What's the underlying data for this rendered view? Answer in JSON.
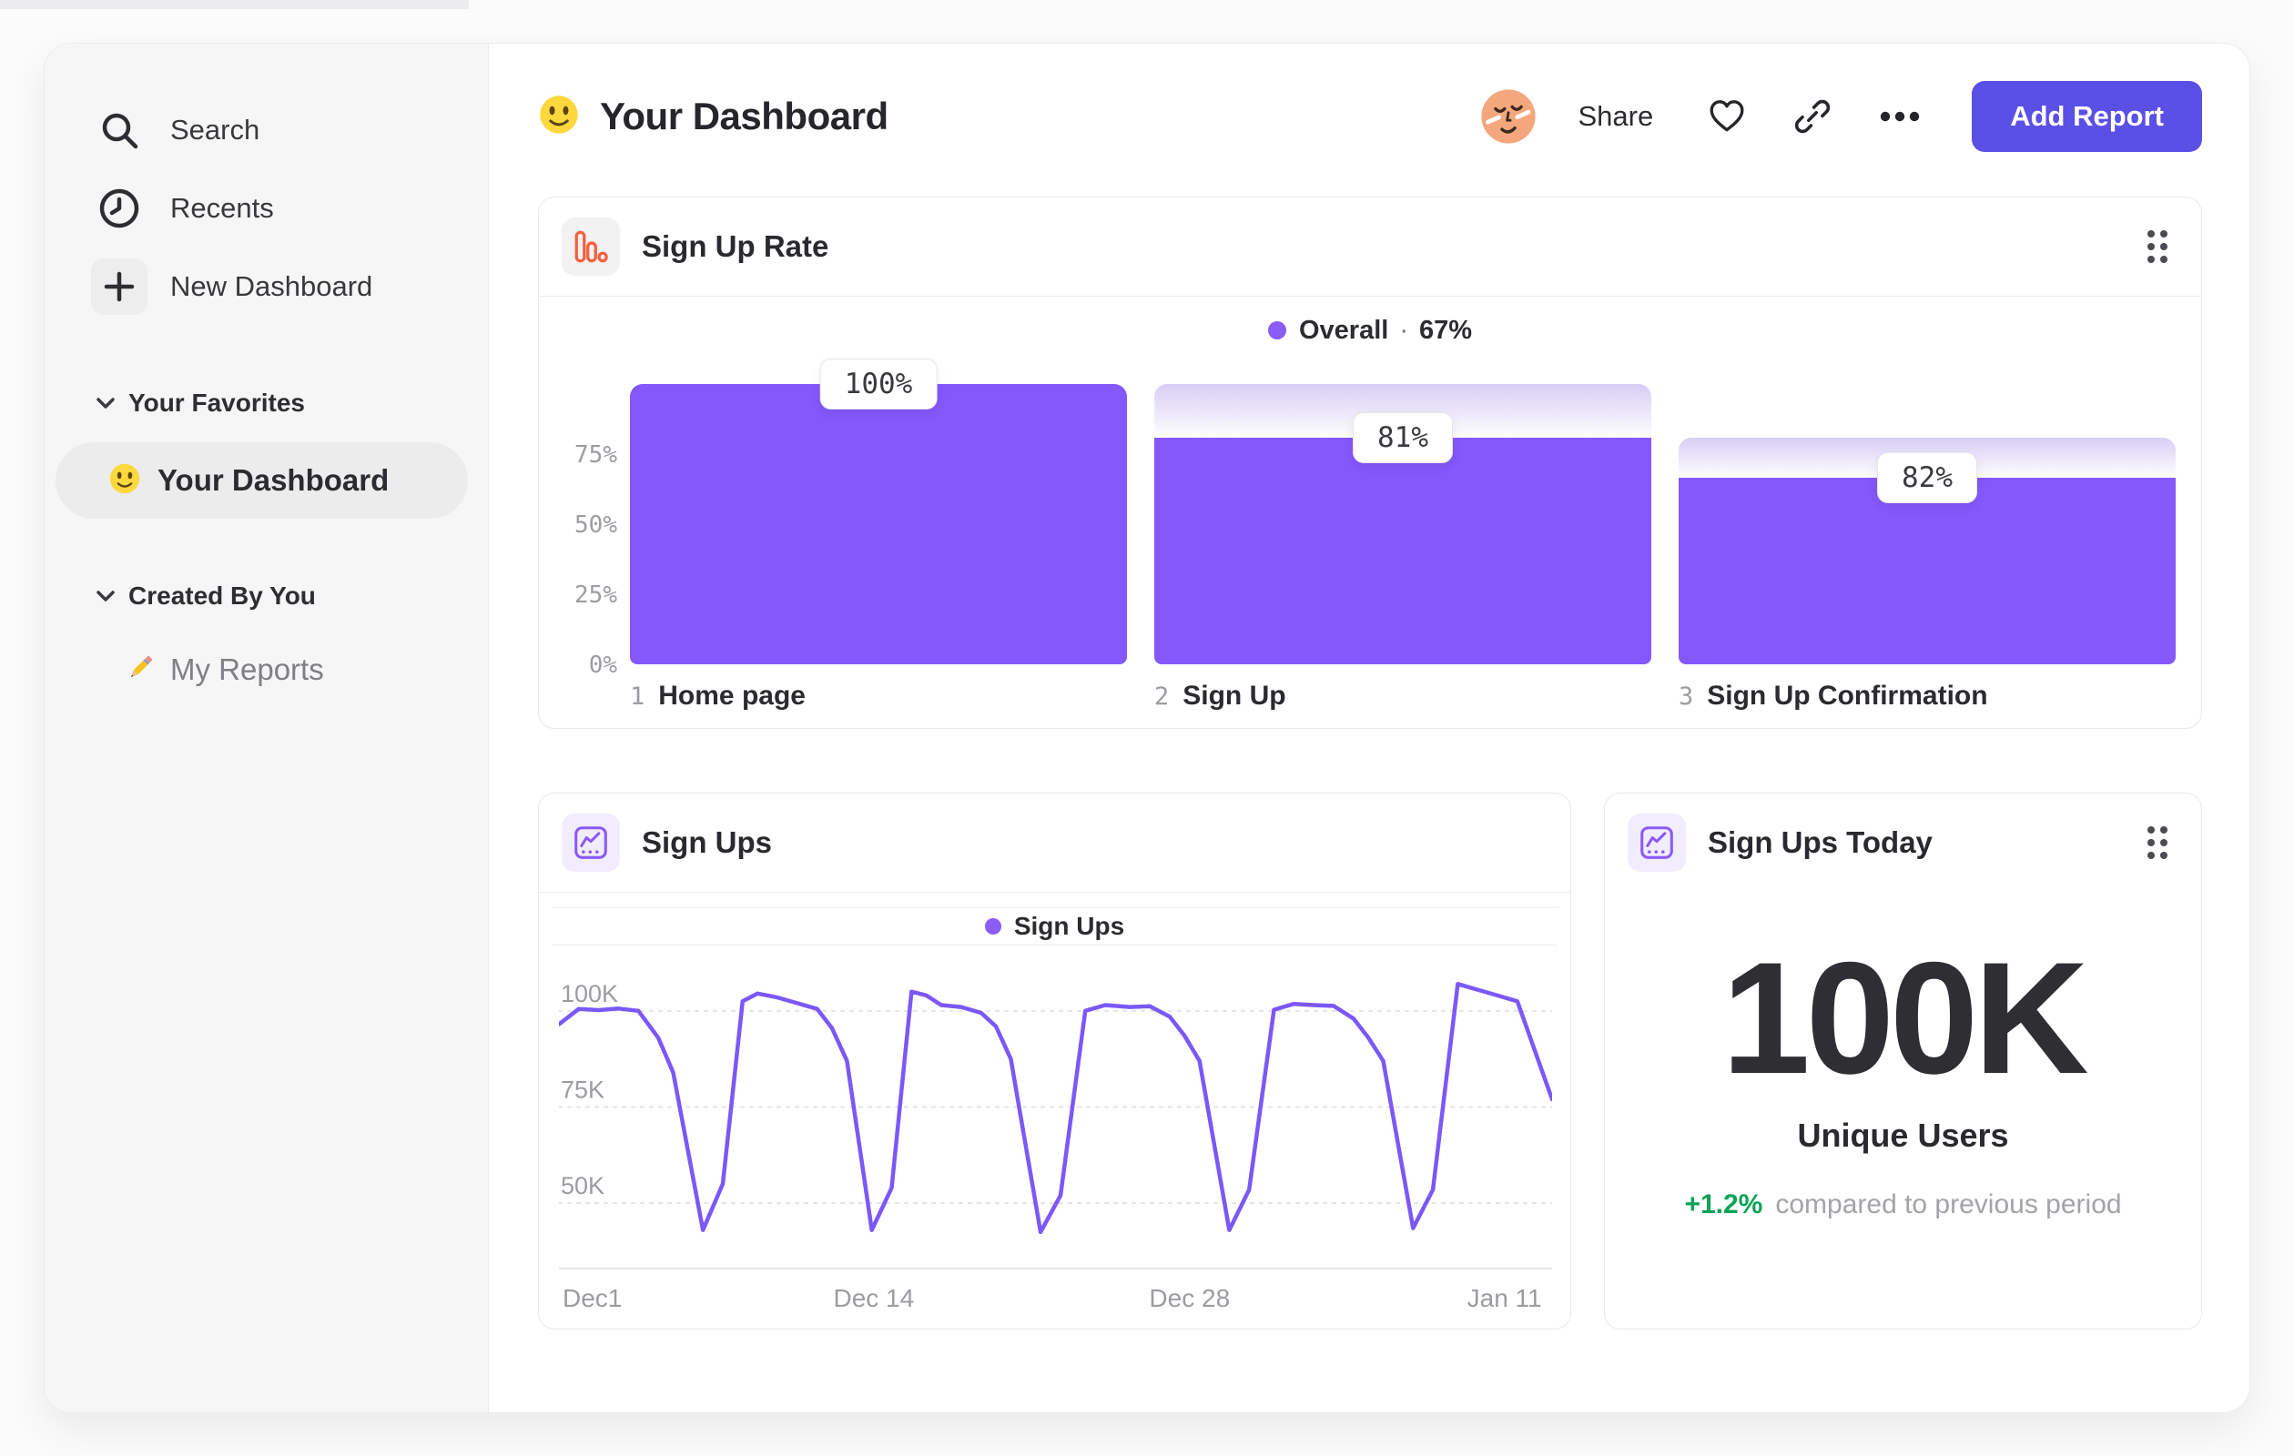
{
  "theme": {
    "bar_purple": "#8458fb",
    "bar_fade_top": "#d8cef5",
    "bar_fade_bottom": "#fefeff",
    "line_purple": "#7b58f8",
    "legend_dot_purple": "#8b5cf6",
    "button_purple": "#5a50e6",
    "funnel_icon_orange": "#f4613e",
    "chart_icon_purple": "#8a5af8",
    "positive_green": "#0aa356",
    "axis_gray": "#9c9ca1"
  },
  "sidebar": {
    "nav_items": [
      {
        "label": "Search",
        "icon": "search-icon"
      },
      {
        "label": "Recents",
        "icon": "clock-icon"
      },
      {
        "label": "New Dashboard",
        "icon": "plus-icon"
      }
    ],
    "sections": [
      {
        "title": "Your Favorites",
        "items": [
          {
            "label": "Your Dashboard",
            "emoji": "smiley",
            "selected": true
          }
        ]
      },
      {
        "title": "Created By You",
        "items": [
          {
            "label": "My Reports",
            "emoji": "pencil",
            "selected": false
          }
        ]
      }
    ]
  },
  "header": {
    "title": "Your Dashboard",
    "share": "Share",
    "add_report": "Add Report"
  },
  "chart_data": [
    {
      "type": "bar",
      "variant": "funnel",
      "title": "Sign Up Rate",
      "legend": {
        "label": "Overall",
        "separator": "·",
        "value": "67%"
      },
      "categories": [
        "Home page",
        "Sign Up",
        "Sign Up Confirmation"
      ],
      "step_numbers": [
        "1",
        "2",
        "3"
      ],
      "step_conversion_pct": [
        100,
        81,
        82
      ],
      "overall_pct": [
        100,
        81,
        66.4
      ],
      "tooltip_labels": [
        "100%",
        "81%",
        "82%"
      ],
      "yticks": [
        {
          "label": "75%",
          "value": 75
        },
        {
          "label": "50%",
          "value": 50
        },
        {
          "label": "25%",
          "value": 25
        },
        {
          "label": "0%",
          "value": 0
        }
      ],
      "ylim": [
        0,
        100
      ],
      "grid": false,
      "legend_position": "top-center"
    },
    {
      "type": "line",
      "title": "Sign Ups",
      "legend": {
        "label": "Sign Ups"
      },
      "ylabel": "",
      "xlabel": "",
      "unit": "K users",
      "ylim": [
        33,
        117
      ],
      "grid": true,
      "grid_style": "dashed",
      "yticks": [
        {
          "label": "100K",
          "value": 100
        },
        {
          "label": "75K",
          "value": 75
        },
        {
          "label": "50K",
          "value": 50
        }
      ],
      "xticks": [
        {
          "label": "Dec1",
          "pos_pct": 0,
          "align": "start"
        },
        {
          "label": "Dec 14",
          "pos_pct": 31.7,
          "align": "middle"
        },
        {
          "label": "Dec 28",
          "pos_pct": 63.5,
          "align": "middle"
        },
        {
          "label": "Jan 11",
          "pos_pct": 95.2,
          "align": "middle"
        }
      ],
      "series": [
        {
          "name": "Sign Ups",
          "points_pct_value": [
            [
              0,
              96.5
            ],
            [
              2,
              100.5
            ],
            [
              4,
              100.2
            ],
            [
              6,
              100.6
            ],
            [
              8,
              100
            ],
            [
              10,
              93
            ],
            [
              11.5,
              84
            ],
            [
              14.5,
              43
            ],
            [
              16.5,
              55
            ],
            [
              18.5,
              102.5
            ],
            [
              20,
              104.5
            ],
            [
              22,
              103.5
            ],
            [
              24,
              102
            ],
            [
              26,
              100.5
            ],
            [
              27.5,
              95.5
            ],
            [
              29,
              87
            ],
            [
              31.5,
              43
            ],
            [
              33.5,
              54
            ],
            [
              35.5,
              105
            ],
            [
              37,
              104
            ],
            [
              38.5,
              101.5
            ],
            [
              40.5,
              101
            ],
            [
              42.5,
              99.5
            ],
            [
              44,
              96
            ],
            [
              45.5,
              87.5
            ],
            [
              48.5,
              42.5
            ],
            [
              50.5,
              52
            ],
            [
              53,
              100
            ],
            [
              55,
              101.5
            ],
            [
              57.5,
              101
            ],
            [
              59.5,
              101.2
            ],
            [
              61.5,
              98.5
            ],
            [
              63,
              93.5
            ],
            [
              64.5,
              87
            ],
            [
              67.5,
              43
            ],
            [
              69.5,
              53.5
            ],
            [
              72,
              100.3
            ],
            [
              74,
              101.8
            ],
            [
              76,
              101.5
            ],
            [
              78,
              101.3
            ],
            [
              80,
              98
            ],
            [
              81.5,
              93
            ],
            [
              83,
              87
            ],
            [
              86,
              43.5
            ],
            [
              88,
              53.5
            ],
            [
              90.5,
              107
            ],
            [
              92.5,
              105.5
            ],
            [
              94.5,
              104
            ],
            [
              96.5,
              102.5
            ],
            [
              100,
              77
            ]
          ]
        }
      ]
    },
    {
      "type": "metric",
      "title": "Sign Ups Today",
      "value": "100K",
      "value_label": "Unique Users",
      "delta": "+1.2%",
      "delta_positive": true,
      "comparison_text": "compared to previous period"
    }
  ]
}
